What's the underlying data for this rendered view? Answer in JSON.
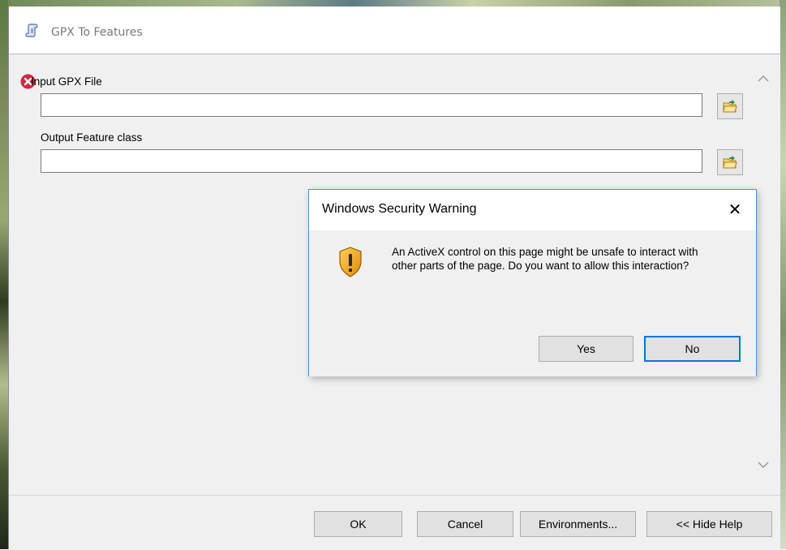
{
  "tool_window": {
    "title": "GPX To Features",
    "fields": [
      {
        "label": "Input GPX File",
        "value": "",
        "has_error": true
      },
      {
        "label": "Output Feature class",
        "value": "",
        "has_error": false
      }
    ],
    "buttons": {
      "ok": "OK",
      "cancel": "Cancel",
      "environments": "Environments...",
      "hide_help": "<< Hide Help"
    }
  },
  "dialog": {
    "title": "Windows Security Warning",
    "close_glyph": "✕",
    "message": "An ActiveX control on this page might be unsafe to interact with other parts of the page. Do you want to allow this interaction?",
    "buttons": {
      "yes": "Yes",
      "no": "No"
    },
    "default_button": "No",
    "icon": "shield-warning-icon"
  },
  "colors": {
    "dialog_border": "#5b8ed6",
    "default_button_border": "#0078d7",
    "error_red": "#d7263d",
    "shield_orange": "#f0a020"
  }
}
